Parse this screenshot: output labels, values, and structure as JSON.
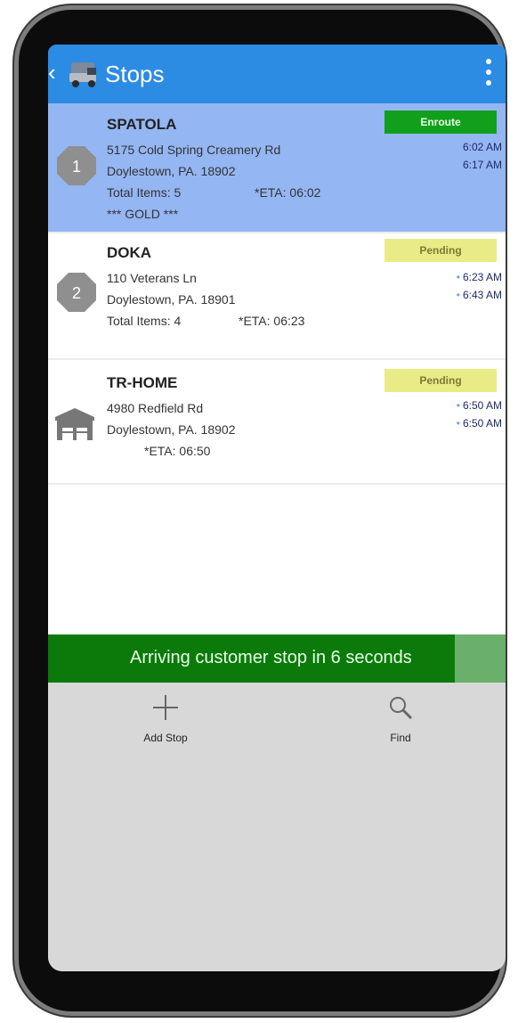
{
  "appbar": {
    "back_icon": "back-chevron-icon",
    "truck_icon": "truck-icon",
    "title": "Stops",
    "menu_icon": "overflow-menu-icon"
  },
  "colors": {
    "appbar": "#2c8be3",
    "active_stop": "#94b6f2",
    "enroute_badge": "#12a01c",
    "pending_badge": "#e9eb87",
    "arrival_banner": "#0b7a0b"
  },
  "stops": [
    {
      "marker": "1",
      "marker_icon": "octagon-number-icon",
      "name": "SPATOLA",
      "address1": "5175 Cold Spring Creamery Rd",
      "address2": "Doylestown, PA. 18902",
      "items": "Total Items: 5",
      "eta": "*ETA: 06:02",
      "note": "*** GOLD ***",
      "status": "Enroute",
      "time1": "6:02 AM",
      "time2": "6:17 AM"
    },
    {
      "marker": "2",
      "marker_icon": "octagon-number-icon",
      "name": "DOKA",
      "address1": "110 Veterans Ln",
      "address2": "Doylestown, PA. 18901",
      "items": "Total Items: 4",
      "eta": "*ETA: 06:23",
      "status": "Pending",
      "time1": "6:23 AM",
      "time2": "6:43 AM"
    },
    {
      "marker_icon": "warehouse-icon",
      "name": "TR-HOME",
      "address1": "4980 Redfield Rd",
      "address2": "Doylestown, PA. 18902",
      "eta": "*ETA: 06:50",
      "status": "Pending",
      "time1": "6:50 AM",
      "time2": "6:50 AM"
    }
  ],
  "arrival_banner": {
    "message": "Arriving customer stop in 6 seconds",
    "progress": 0.89
  },
  "toolbar": {
    "add_stop_label": "Add Stop",
    "add_icon": "plus-icon",
    "find_label": "Find",
    "find_icon": "search-icon"
  }
}
